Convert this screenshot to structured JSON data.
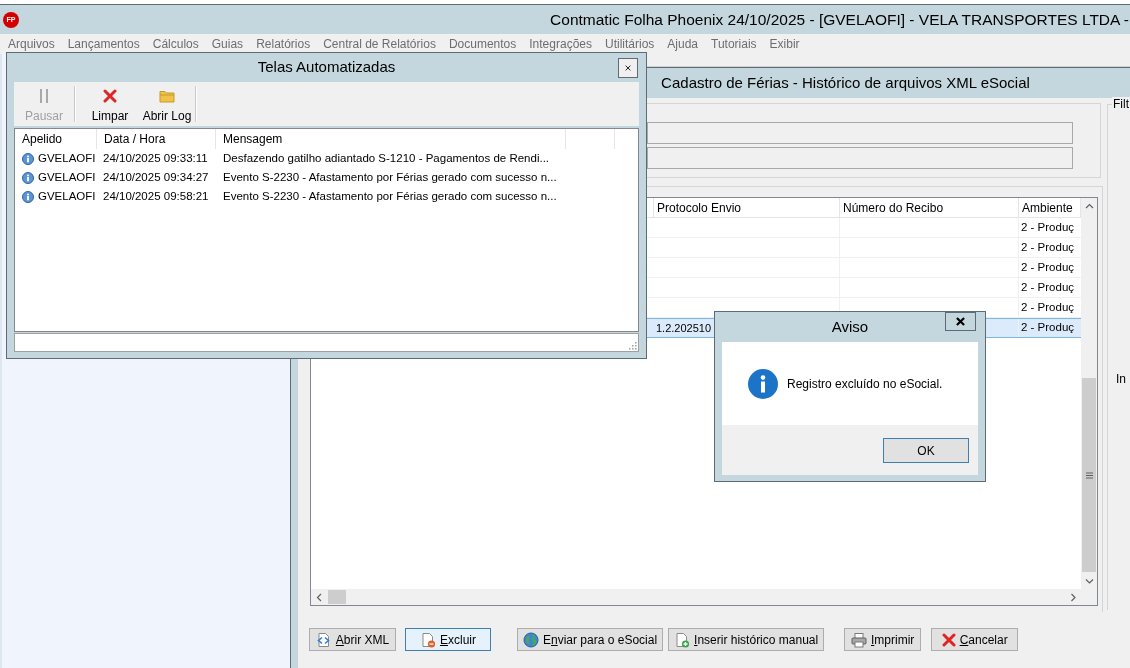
{
  "app": {
    "logo": "FP",
    "title": "Contmatic Folha Phoenix 24/10/2025 - [GVELAOFI] - VELA TRANSPORTES LTDA -"
  },
  "menu": [
    {
      "label": "Arquivos",
      "disabled": true
    },
    {
      "label": "Lançamentos",
      "disabled": true
    },
    {
      "label": "Cálculos",
      "disabled": true
    },
    {
      "label": "Guias",
      "disabled": true
    },
    {
      "label": "Relatórios",
      "disabled": true
    },
    {
      "label": "Central de Relatórios",
      "disabled": true
    },
    {
      "label": "Documentos",
      "disabled": true
    },
    {
      "label": "Integrações",
      "disabled": true
    },
    {
      "label": "Utilitários",
      "disabled": true
    },
    {
      "label": "Ajuda",
      "disabled": true
    },
    {
      "label": "Tutoriais",
      "disabled": true
    },
    {
      "label": "Exibir",
      "disabled": true
    }
  ],
  "cadastro_window": {
    "title": "Cadastro de Férias - Histórico de arquivos XML eSocial",
    "grid": {
      "columns": [
        "Protocolo Envio",
        "Número do Recibo",
        "Ambiente"
      ],
      "rows": [
        {
          "ambiente": "2 - Produç",
          "selected": false
        },
        {
          "ambiente": "2 - Produç",
          "selected": false
        },
        {
          "ambiente": "2 - Produç",
          "selected": false
        },
        {
          "ambiente": "2 - Produç",
          "selected": false
        },
        {
          "ambiente": "2 - Produç",
          "selected": false
        },
        {
          "protocolo_envio": "1.2.202510",
          "ambiente": "2 - Produç",
          "selected": true
        }
      ]
    },
    "buttons": [
      {
        "kind": "xml",
        "accelerator": "A",
        "after": "brir XML",
        "focused": false
      },
      {
        "kind": "delete",
        "accelerator": "E",
        "after": "xcluir",
        "focused": true
      },
      {
        "kind": "send",
        "before": "E",
        "accelerator": "n",
        "after": "viar para o eSocial",
        "focused": false
      },
      {
        "kind": "insert",
        "accelerator": "I",
        "after": "nserir histórico manual",
        "focused": false
      },
      {
        "kind": "print",
        "accelerator": "I",
        "after": "mprimir",
        "focused": false
      },
      {
        "kind": "cancel",
        "accelerator": "C",
        "after": "ancelar",
        "focused": false
      }
    ],
    "side_panel": {
      "title": "Filt",
      "labels": [
        "In"
      ]
    }
  },
  "telas_window": {
    "title": "Telas Automatizadas",
    "toolbar": [
      {
        "kind": "pause",
        "label": "Pausar",
        "disabled": true
      },
      {
        "kind": "clear",
        "label": "Limpar",
        "disabled": false
      },
      {
        "kind": "open_log",
        "label": "Abrir Log",
        "disabled": false
      }
    ],
    "columns": [
      "Apelido",
      "Data / Hora",
      "Mensagem"
    ],
    "rows": [
      {
        "apelido": "GVELAOFI",
        "data_hora": "24/10/2025 09:33:11",
        "mensagem": "Desfazendo gatilho adiantado S-1210 - Pagamentos de Rendi..."
      },
      {
        "apelido": "GVELAOFI",
        "data_hora": "24/10/2025 09:34:27",
        "mensagem": "Evento S-2230 - Afastamento por Férias gerado com sucesso n..."
      },
      {
        "apelido": "GVELAOFI",
        "data_hora": "24/10/2025 09:58:21",
        "mensagem": "Evento S-2230 - Afastamento por Férias gerado com sucesso n..."
      }
    ]
  },
  "dialog": {
    "title": "Aviso",
    "message": "Registro excluído no eSocial.",
    "button": "OK"
  }
}
